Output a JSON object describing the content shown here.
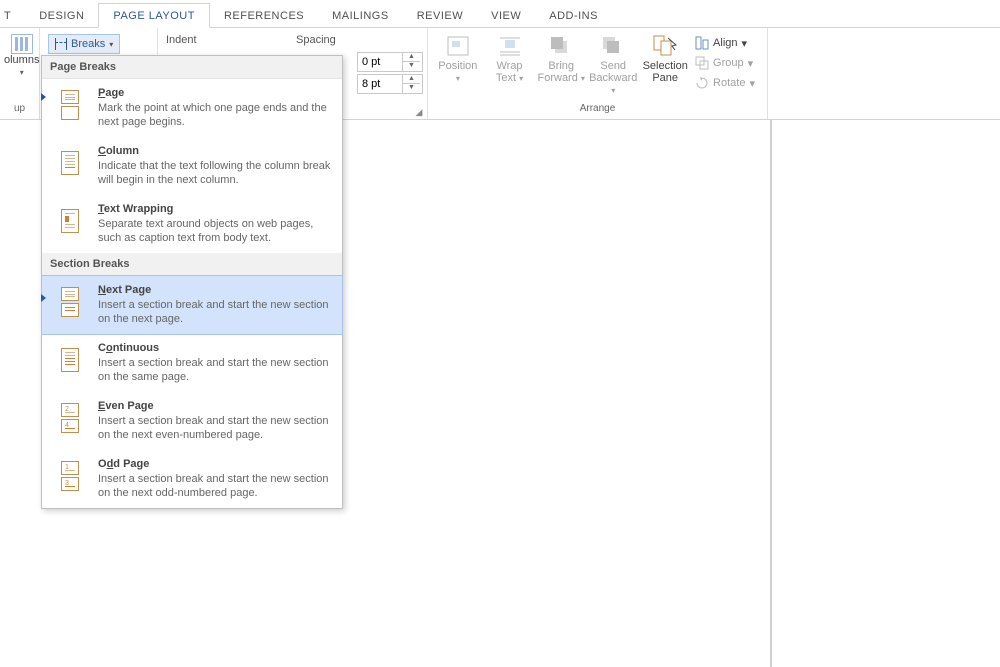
{
  "tabs": {
    "t0": "T",
    "design": "DESIGN",
    "page_layout": "PAGE LAYOUT",
    "references": "REFERENCES",
    "mailings": "MAILINGS",
    "review": "REVIEW",
    "view": "VIEW",
    "addins": "ADD-INS"
  },
  "left": {
    "columns_label": "olumns",
    "columns_small": "up"
  },
  "breaks_btn": "Breaks",
  "paragraph": {
    "indent_label": "Indent",
    "spacing_label": "Spacing",
    "before_val": "0 pt",
    "after_val": "8 pt",
    "group_label": ""
  },
  "arrange": {
    "position": "Position",
    "wrap": "Wrap",
    "wrap2": "Text",
    "bring": "Bring",
    "bring2": "Forward",
    "send": "Send",
    "send2": "Backward",
    "selpane": "Selection",
    "selpane2": "Pane",
    "align": "Align",
    "group": "Group",
    "rotate": "Rotate",
    "group_label": "Arrange"
  },
  "dropdown": {
    "h1": "Page Breaks",
    "page_t": "Page",
    "page_d": "Mark the point at which one page ends and the next page begins.",
    "col_t": "Column",
    "col_d": "Indicate that the text following the column break will begin in the next column.",
    "tw_t": "Text Wrapping",
    "tw_d": "Separate text around objects on web pages, such as caption text from body text.",
    "h2": "Section Breaks",
    "np_t": "Next Page",
    "np_d": "Insert a section break and start the new section on the next page.",
    "cont_t": "Continuous",
    "cont_d": "Insert a section break and start the new section on the same page.",
    "ev_t": "Even Page",
    "ev_d": "Insert a section break and start the new section on the next even-numbered page.",
    "od_t": "Odd Page",
    "od_d": "Insert a section break and start the new section on the next odd-numbered page."
  }
}
